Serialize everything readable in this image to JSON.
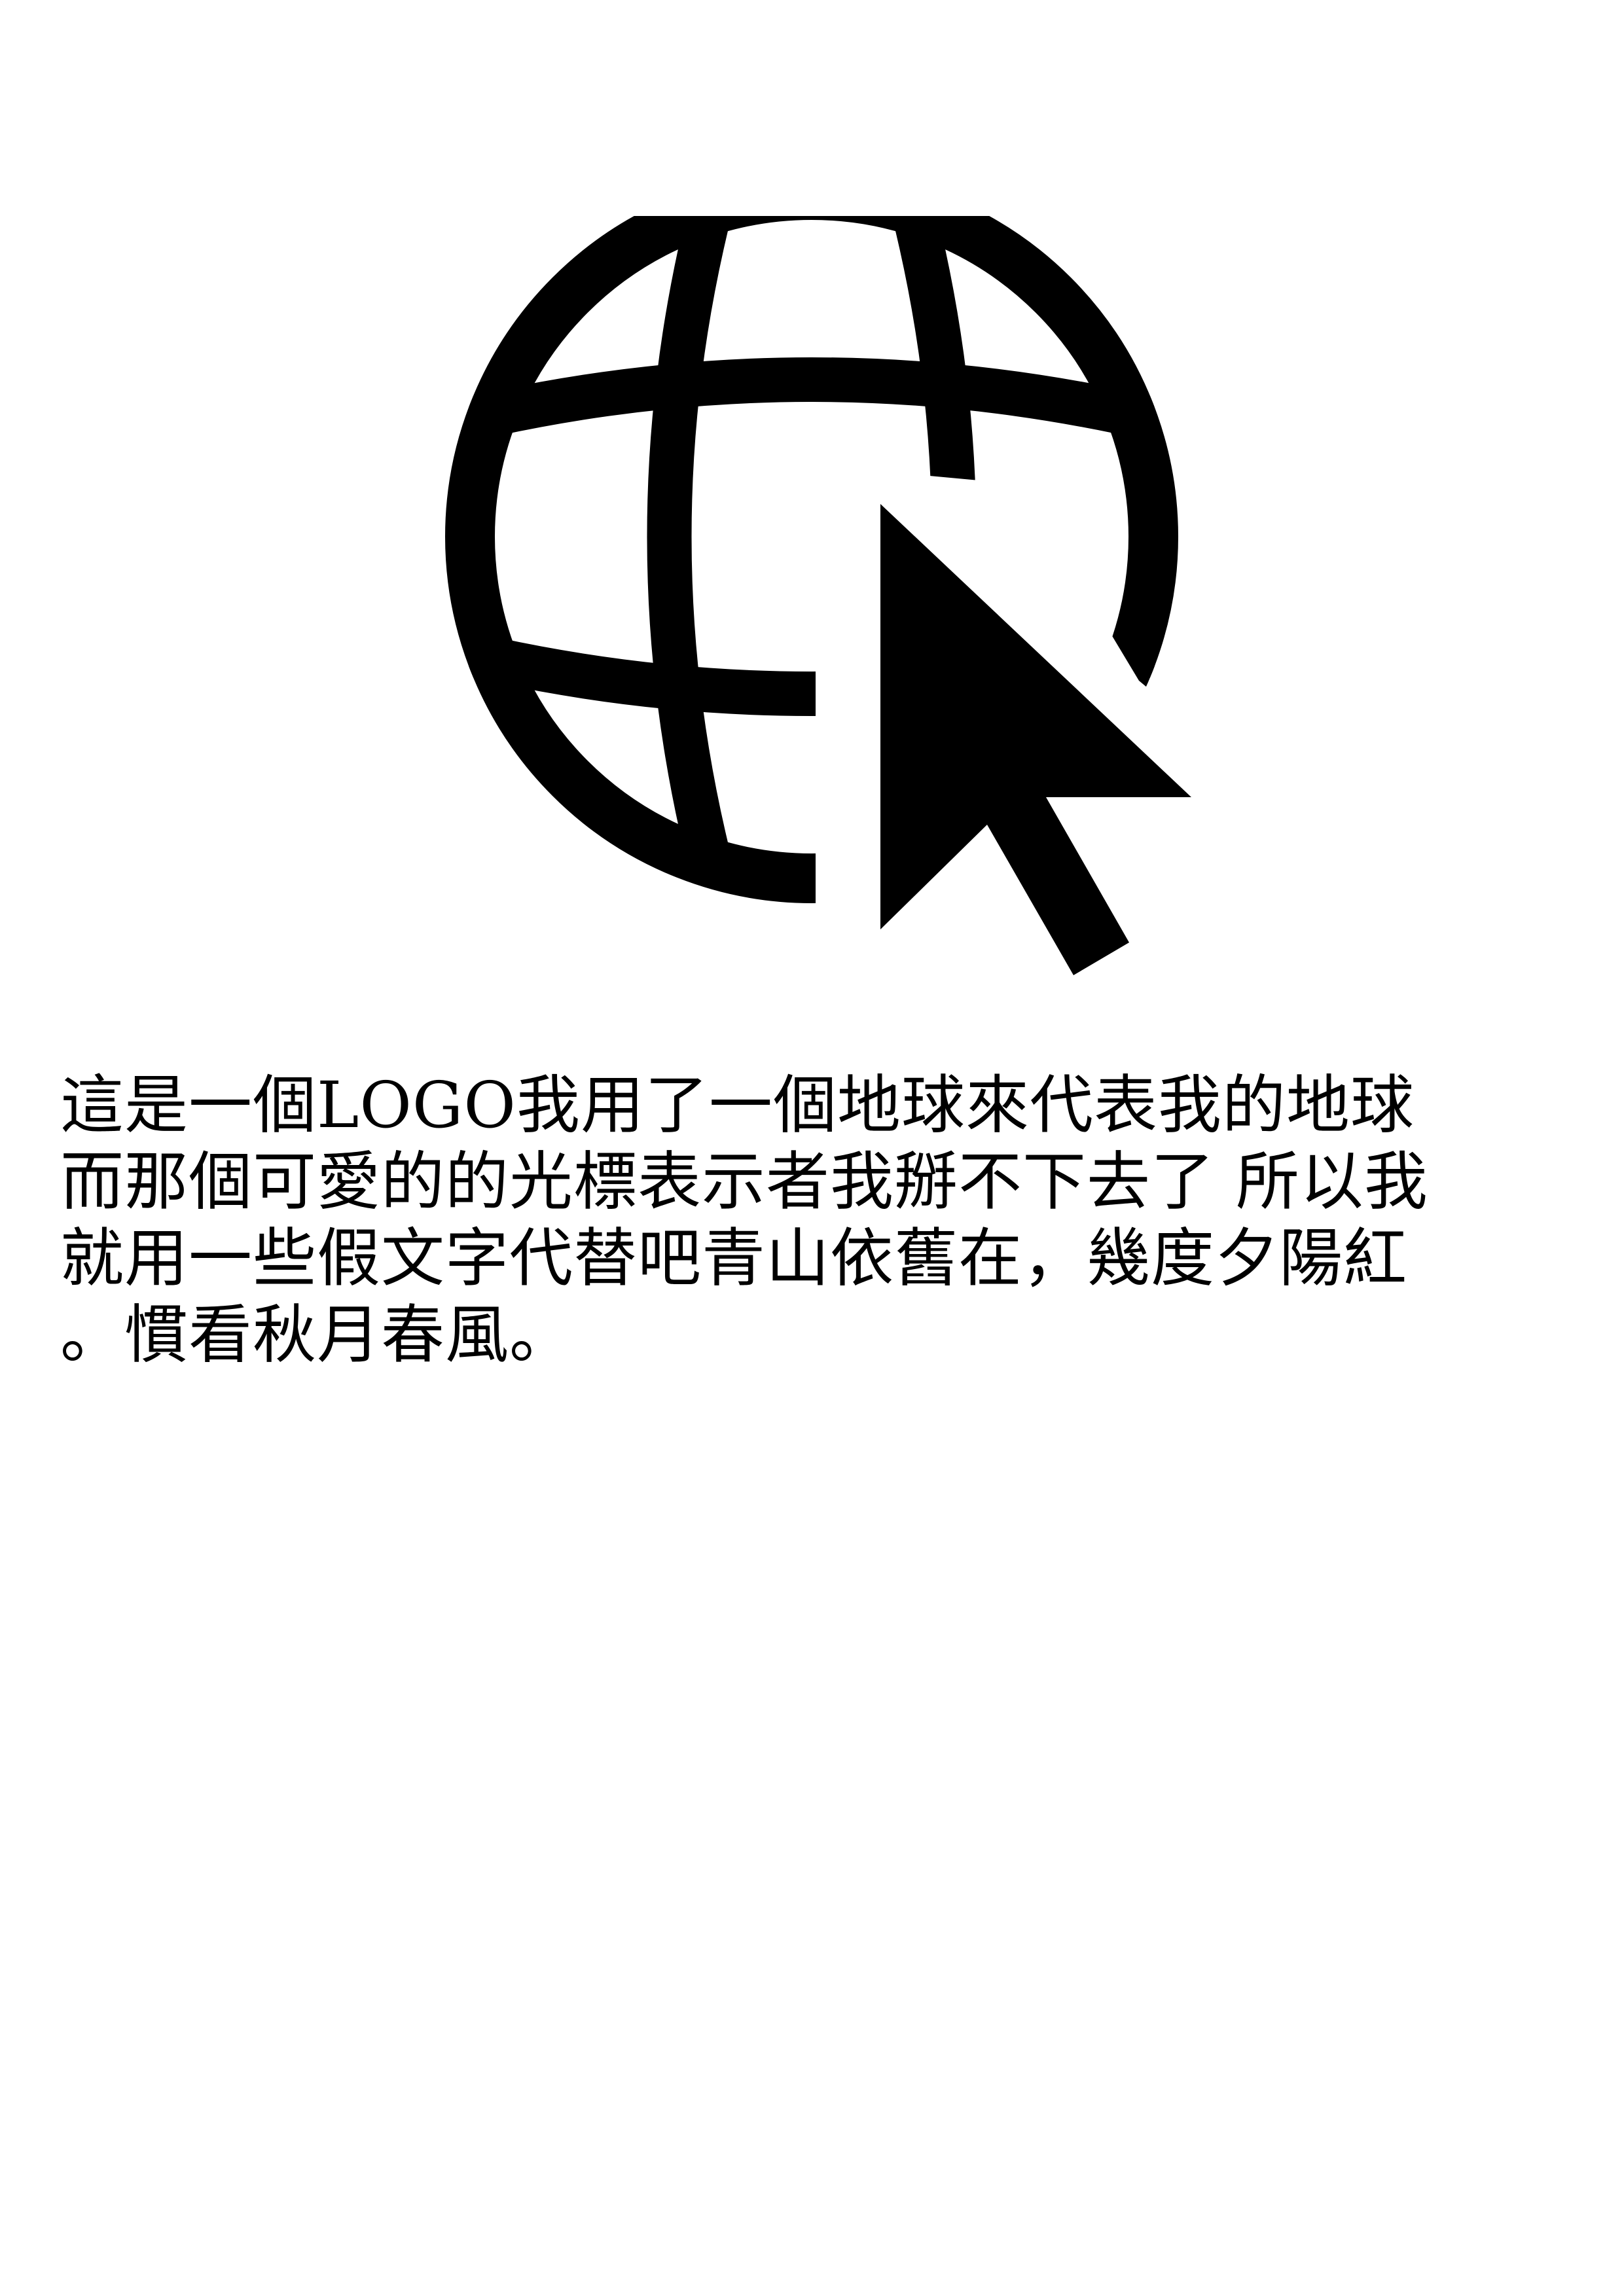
{
  "logo": {
    "icon": "globe-with-cursor-icon",
    "color": "#000000"
  },
  "paragraph": {
    "lines": [
      "這是一個LOGO我用了一個地球來代表我的地球",
      "而那個可愛的的光標表示者我掰不下去了 所以我",
      "就用一些假文字代替吧青山依舊在，幾度夕陽紅",
      "。慣看秋月春風。"
    ]
  }
}
